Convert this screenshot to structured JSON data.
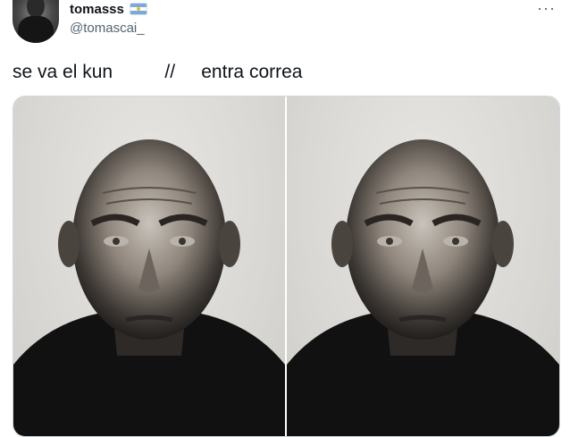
{
  "user": {
    "name": "tomasss",
    "handle": "@tomascai_"
  },
  "menu": {
    "more_glyph": "···"
  },
  "tweet": {
    "text": "se va el kun          //     entra correa"
  },
  "media": {
    "count": 2,
    "images": [
      {
        "description": "portrait-left"
      },
      {
        "description": "portrait-right"
      }
    ]
  },
  "colors": {
    "text_primary": "#0f1419",
    "text_secondary": "#536471",
    "border": "#cfd9de",
    "background": "#ffffff"
  }
}
